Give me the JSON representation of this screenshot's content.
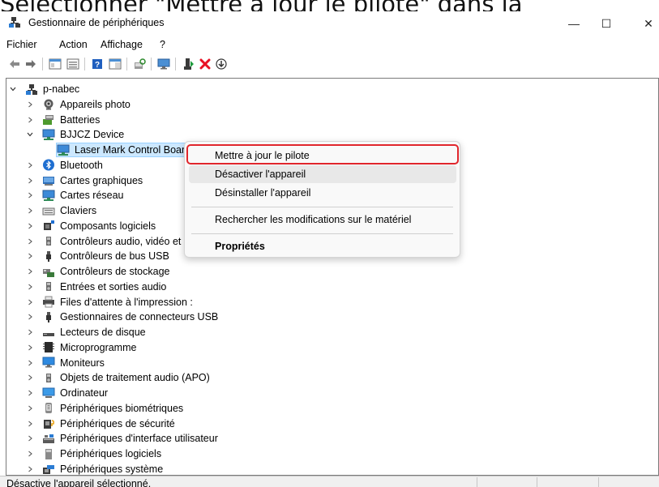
{
  "caption": "Sélectionner \"Mettre à jour le pilote\" dans la",
  "window": {
    "title": "Gestionnaire de périphériques",
    "controls": {
      "minimize": "—",
      "maximize": "☐",
      "close": "✕"
    }
  },
  "menubar": [
    "Fichier",
    "Action",
    "Affichage",
    "?"
  ],
  "tree": {
    "root": "p-nabec",
    "items": [
      {
        "label": "Appareils photo",
        "icon": "camera-icon",
        "state": "collapsed"
      },
      {
        "label": "Batteries",
        "icon": "battery-icon",
        "state": "collapsed"
      },
      {
        "label": "BJJCZ Device",
        "icon": "monitor-network-icon",
        "state": "expanded"
      },
      {
        "label": "Laser Mark Control Boar",
        "icon": "monitor-network-icon",
        "state": "child-selected"
      },
      {
        "label": "Bluetooth",
        "icon": "bluetooth-icon",
        "state": "collapsed"
      },
      {
        "label": "Cartes graphiques",
        "icon": "display-adapter-icon",
        "state": "collapsed"
      },
      {
        "label": "Cartes réseau",
        "icon": "network-adapter-icon",
        "state": "collapsed"
      },
      {
        "label": "Claviers",
        "icon": "keyboard-icon",
        "state": "collapsed"
      },
      {
        "label": "Composants logiciels",
        "icon": "software-component-icon",
        "state": "collapsed"
      },
      {
        "label": "Contrôleurs audio, vidéo et",
        "icon": "speaker-icon",
        "state": "collapsed"
      },
      {
        "label": "Contrôleurs de bus USB",
        "icon": "usb-icon",
        "state": "collapsed"
      },
      {
        "label": "Contrôleurs de stockage",
        "icon": "storage-controller-icon",
        "state": "collapsed"
      },
      {
        "label": "Entrées et sorties audio",
        "icon": "speaker-icon",
        "state": "collapsed"
      },
      {
        "label": "Files d'attente à l'impression :",
        "icon": "printer-icon",
        "state": "collapsed"
      },
      {
        "label": "Gestionnaires de connecteurs USB",
        "icon": "usb-icon",
        "state": "collapsed"
      },
      {
        "label": "Lecteurs de disque",
        "icon": "disk-drive-icon",
        "state": "collapsed"
      },
      {
        "label": "Microprogramme",
        "icon": "firmware-icon",
        "state": "collapsed"
      },
      {
        "label": "Moniteurs",
        "icon": "monitor-icon",
        "state": "collapsed"
      },
      {
        "label": "Objets de traitement audio (APO)",
        "icon": "speaker-icon",
        "state": "collapsed"
      },
      {
        "label": "Ordinateur",
        "icon": "computer-icon",
        "state": "collapsed"
      },
      {
        "label": "Périphériques biométriques",
        "icon": "biometric-icon",
        "state": "collapsed"
      },
      {
        "label": "Périphériques de sécurité",
        "icon": "security-device-icon",
        "state": "collapsed"
      },
      {
        "label": "Périphériques d'interface utilisateur",
        "icon": "hid-icon",
        "state": "collapsed"
      },
      {
        "label": "Périphériques logiciels",
        "icon": "software-device-icon",
        "state": "collapsed"
      },
      {
        "label": "Périphériques système",
        "icon": "system-device-icon",
        "state": "collapsed"
      }
    ]
  },
  "context_menu": {
    "items": [
      {
        "label": "Mettre à jour le pilote",
        "highlighted": true
      },
      {
        "label": "Désactiver l'appareil",
        "hover": true
      },
      {
        "label": "Désinstaller l'appareil"
      },
      {
        "label": "Rechercher les modifications sur le matériel"
      },
      {
        "label": "Propriétés",
        "bold": true
      }
    ]
  },
  "statusbar": {
    "text": "Désactive l'appareil sélectionné."
  },
  "colors": {
    "selection": "#cce8ff",
    "highlight_border": "#e0262c",
    "delete_red": "#e81123"
  }
}
